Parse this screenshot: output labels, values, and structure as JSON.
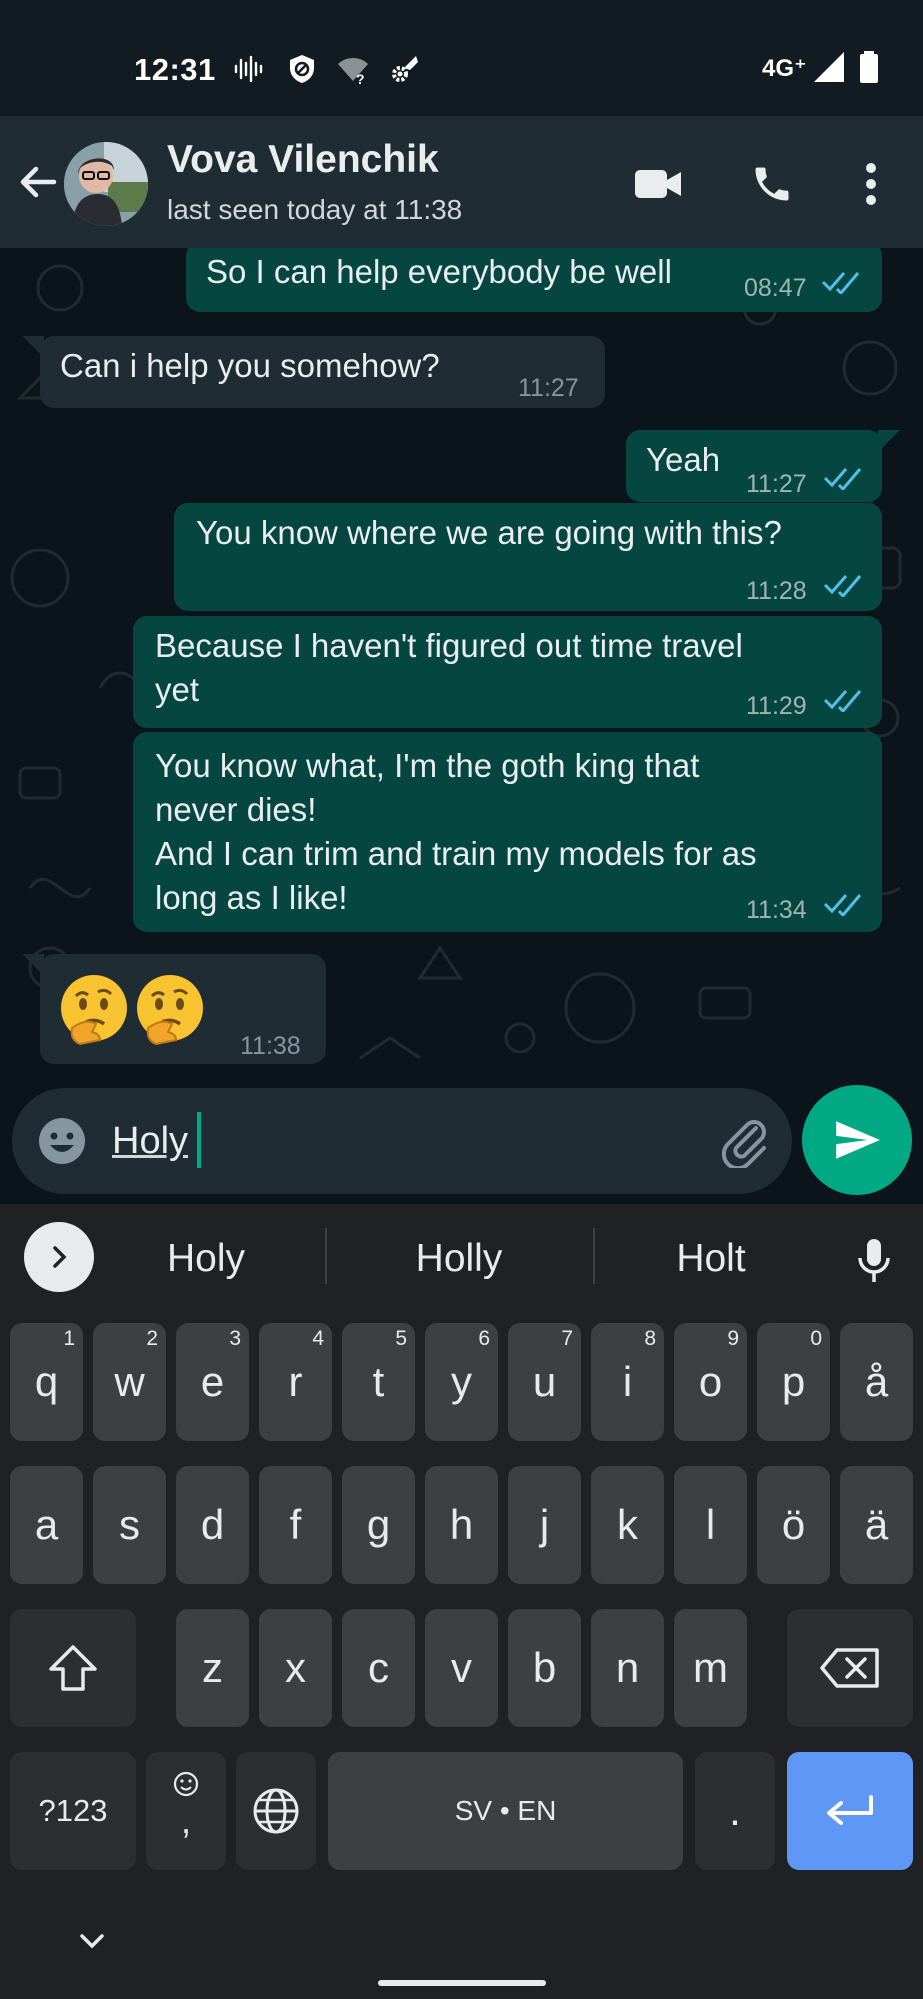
{
  "status_bar": {
    "time": "12:31",
    "network": "4G⁺",
    "icons": [
      "sound-wave-icon",
      "shield-icon",
      "wifi-unknown-icon",
      "settings-sync-icon",
      "signal-icon",
      "battery-icon"
    ]
  },
  "header": {
    "name": "Vova Vilenchik",
    "status": "last seen today at 11:38",
    "icons": [
      "back-arrow-icon",
      "video-call-icon",
      "phone-call-icon",
      "more-vert-icon"
    ]
  },
  "messages": [
    {
      "direction": "out",
      "text": "So I can help everybody be well",
      "time": "08:47",
      "ticks": "read"
    },
    {
      "direction": "in",
      "text": "Can i help you somehow?",
      "time": "11:27"
    },
    {
      "direction": "out",
      "text": "Yeah",
      "time": "11:27",
      "ticks": "read"
    },
    {
      "direction": "out",
      "text": "You know where we are going with this?",
      "time": "11:28",
      "ticks": "read"
    },
    {
      "direction": "out",
      "text": "Because I haven't figured out time travel\nyet",
      "time": "11:29",
      "ticks": "read"
    },
    {
      "direction": "out",
      "text": "You know what, I'm the goth king that\nnever dies!\nAnd I can trim and train my models for as\nlong as I like!",
      "time": "11:34",
      "ticks": "read"
    },
    {
      "direction": "in",
      "text": "",
      "emoji": [
        "thinking-face",
        "thinking-face"
      ],
      "time": "11:38"
    }
  ],
  "composer": {
    "text": "Holy",
    "icons": [
      "emoji-icon",
      "attach-icon",
      "send-icon"
    ]
  },
  "keyboard": {
    "suggestions": [
      "Holy",
      "Holly",
      "Holt"
    ],
    "row1": [
      {
        "k": "q",
        "s": "1"
      },
      {
        "k": "w",
        "s": "2"
      },
      {
        "k": "e",
        "s": "3"
      },
      {
        "k": "r",
        "s": "4"
      },
      {
        "k": "t",
        "s": "5"
      },
      {
        "k": "y",
        "s": "6"
      },
      {
        "k": "u",
        "s": "7"
      },
      {
        "k": "i",
        "s": "8"
      },
      {
        "k": "o",
        "s": "9"
      },
      {
        "k": "p",
        "s": "0"
      },
      {
        "k": "å",
        "s": ""
      }
    ],
    "row2": [
      "a",
      "s",
      "d",
      "f",
      "g",
      "h",
      "j",
      "k",
      "l",
      "ö",
      "ä"
    ],
    "row3": [
      "z",
      "x",
      "c",
      "v",
      "b",
      "n",
      "m"
    ],
    "symbols_key": "?123",
    "comma_key": ",",
    "space_label": "SV • EN",
    "period_key": "."
  },
  "colors": {
    "outgoing_bubble": "#054740",
    "incoming_bubble": "#1f2c33",
    "accent": "#00a884",
    "read_ticks": "#53bdeb",
    "enter_key": "#5e97f6"
  }
}
